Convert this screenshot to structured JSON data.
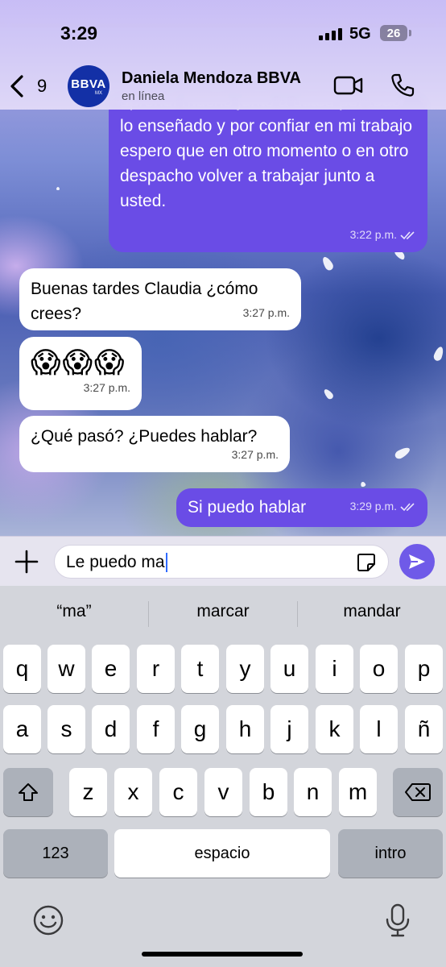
{
  "status_bar": {
    "time": "3:29",
    "network": "5G",
    "battery": "26"
  },
  "header": {
    "back_count": "9",
    "avatar_brand": "BBVA",
    "avatar_sub": "MX",
    "contact_name": "Daniela Mendoza BBVA",
    "contact_status": "en línea",
    "video_icon": "video-camera-icon",
    "call_icon": "phone-icon"
  },
  "messages": [
    {
      "direction": "out",
      "text": "aprendí mucho junto a usted por todo lo enseñado y por confiar en mi trabajo espero que en otro momento o en otro despacho volver a trabajar junto a usted.",
      "time": "3:22 p.m.",
      "read": true
    },
    {
      "direction": "in",
      "text": "Buenas tardes Claudia ¿cómo crees?",
      "time": "3:27 p.m."
    },
    {
      "direction": "in",
      "text": "😱😱😱",
      "time": "3:27 p.m."
    },
    {
      "direction": "in",
      "text": "¿Qué pasó? ¿Puedes hablar?",
      "time": "3:27 p.m."
    },
    {
      "direction": "out",
      "text": "Si puedo hablar",
      "time": "3:29 p.m.",
      "read": true
    }
  ],
  "composer": {
    "value": "Le puedo ma"
  },
  "keyboard": {
    "suggestions": [
      "“ma”",
      "marcar",
      "mandar"
    ],
    "row1": [
      "q",
      "w",
      "e",
      "r",
      "t",
      "y",
      "u",
      "i",
      "o",
      "p"
    ],
    "row2": [
      "a",
      "s",
      "d",
      "f",
      "g",
      "h",
      "j",
      "k",
      "l",
      "ñ"
    ],
    "row3": [
      "z",
      "x",
      "c",
      "v",
      "b",
      "n",
      "m"
    ],
    "numbers_key": "123",
    "space_key": "espacio",
    "return_key": "intro"
  },
  "colors": {
    "outgoing": "#6a4ce6",
    "incoming": "#ffffff",
    "accent": "#6f5ae8"
  }
}
